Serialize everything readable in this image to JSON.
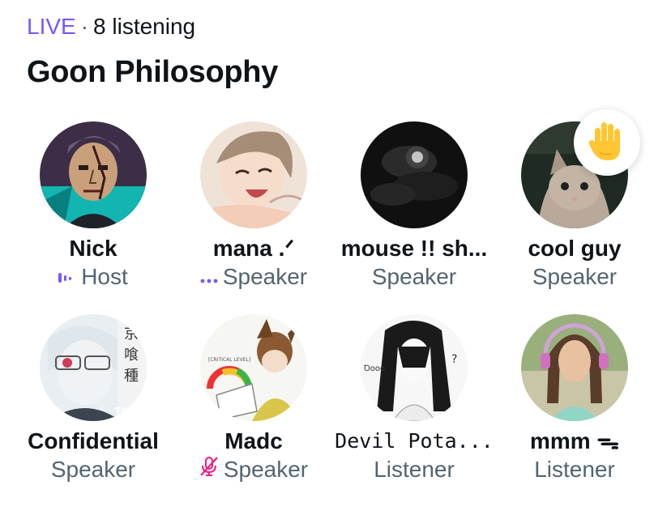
{
  "space": {
    "live_label": "LIVE",
    "separator": "·",
    "listening": "8 listening",
    "title": "Goon Philosophy"
  },
  "colors": {
    "accent": "#7856ff",
    "muted_mic": "#f91880",
    "secondary_text": "#536471",
    "raised_hand": "#ffc533"
  },
  "participants": [
    {
      "name": "Nick",
      "role": "Host",
      "role_icon": "speaking-bars-icon"
    },
    {
      "name": "mana .ᐟ",
      "role": "Speaker",
      "role_icon": "speaking-dots-icon"
    },
    {
      "name": "mouse !! sh...",
      "role": "Speaker",
      "role_icon": ""
    },
    {
      "name": "cool guy",
      "role": "Speaker",
      "role_icon": "",
      "badge": "raised-hand-icon"
    },
    {
      "name": "Confidential",
      "role": "Speaker",
      "role_icon": ""
    },
    {
      "name": "Madc",
      "role": "Speaker",
      "role_icon": "mic-muted-icon"
    },
    {
      "name": "Devil Pota...",
      "role": "Listener",
      "role_icon": ""
    },
    {
      "name": "mmm ᯓ",
      "role": "Listener",
      "role_icon": ""
    }
  ]
}
